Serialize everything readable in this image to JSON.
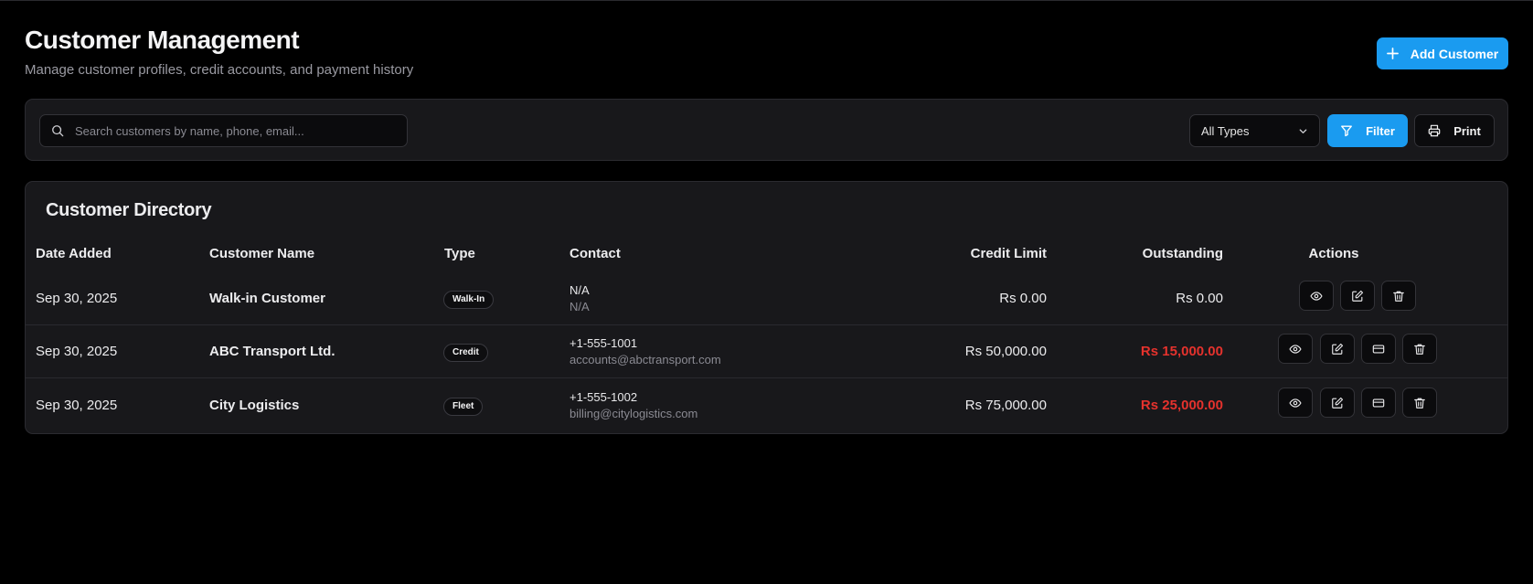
{
  "header": {
    "title": "Customer Management",
    "subtitle": "Manage customer profiles, credit accounts, and payment history",
    "add_button": "Add Customer"
  },
  "toolbar": {
    "search_placeholder": "Search customers by name, phone, email...",
    "type_select": "All Types",
    "filter_label": "Filter",
    "print_label": "Print"
  },
  "directory": {
    "title": "Customer Directory",
    "columns": [
      "Date Added",
      "Customer Name",
      "Type",
      "Contact",
      "Credit Limit",
      "Outstanding",
      "Actions"
    ],
    "rows": [
      {
        "date": "Sep 30, 2025",
        "name": "Walk-in Customer",
        "type": "Walk-In",
        "phone": "N/A",
        "email": "N/A",
        "credit_limit": "Rs 0.00",
        "outstanding": "Rs 0.00",
        "outstanding_alert": false
      },
      {
        "date": "Sep 30, 2025",
        "name": "ABC Transport Ltd.",
        "type": "Credit",
        "phone": "+1-555-1001",
        "email": "accounts@abctransport.com",
        "credit_limit": "Rs 50,000.00",
        "outstanding": "Rs 15,000.00",
        "outstanding_alert": true
      },
      {
        "date": "Sep 30, 2025",
        "name": "City Logistics",
        "type": "Fleet",
        "phone": "+1-555-1002",
        "email": "billing@citylogistics.com",
        "credit_limit": "Rs 75,000.00",
        "outstanding": "Rs 25,000.00",
        "outstanding_alert": true
      }
    ]
  },
  "colors": {
    "accent": "#1a9bf0",
    "alert": "#e5322d",
    "background": "#000000",
    "card": "#18181b"
  },
  "icons": [
    "plus-icon",
    "search-icon",
    "chevron-down-icon",
    "filter-icon",
    "printer-icon",
    "eye-icon",
    "edit-icon",
    "credit-card-icon",
    "trash-icon"
  ]
}
